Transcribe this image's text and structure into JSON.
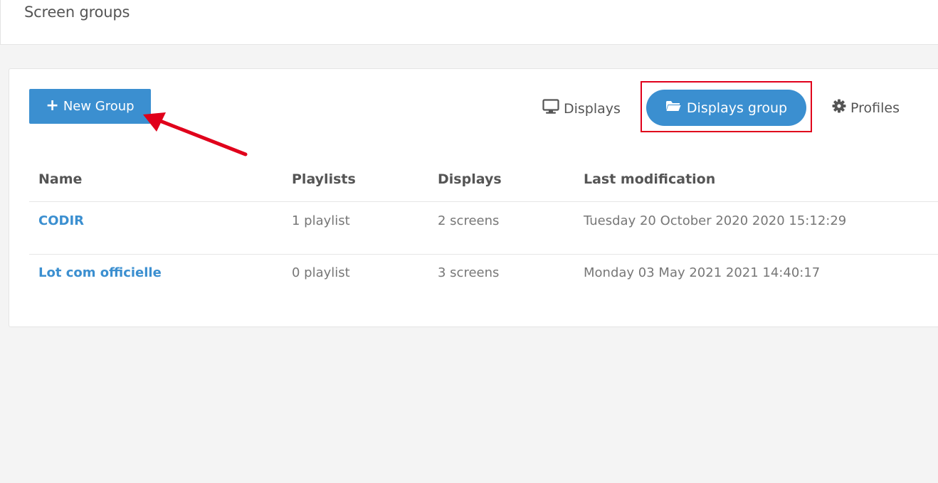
{
  "header": {
    "title": "Screen groups"
  },
  "toolbar": {
    "new_group_label": "New Group"
  },
  "tabs": [
    {
      "label": "Displays",
      "icon": "monitor-icon",
      "active": false
    },
    {
      "label": "Displays group",
      "icon": "folder-open-icon",
      "active": true
    },
    {
      "label": "Profiles",
      "icon": "gear-icon",
      "active": false
    }
  ],
  "table": {
    "columns": [
      "Name",
      "Playlists",
      "Displays",
      "Last modification"
    ],
    "rows": [
      {
        "name": "CODIR",
        "playlists": "1 playlist",
        "displays": "2 screens",
        "modified": "Tuesday 20 October 2020 2020 15:12:29"
      },
      {
        "name": "Lot com officielle",
        "playlists": "0 playlist",
        "displays": "3 screens",
        "modified": "Monday 03 May 2021 2021 14:40:17"
      }
    ]
  },
  "colors": {
    "accent": "#3b8fd0",
    "annotation": "#e0001b",
    "text": "#555555",
    "muted": "#777777"
  }
}
